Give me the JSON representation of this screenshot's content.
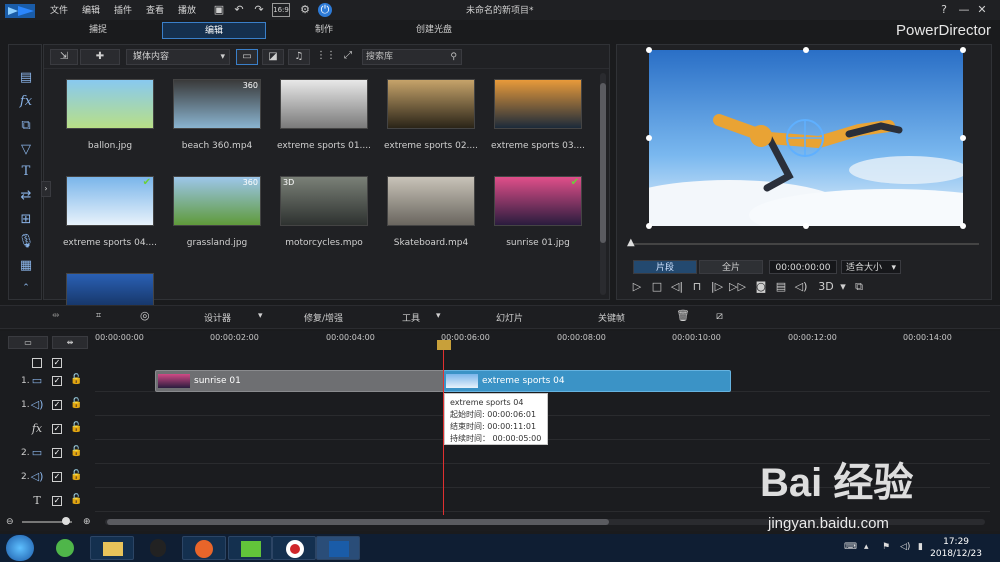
{
  "menu": [
    "文件",
    "编辑",
    "插件",
    "查看",
    "播放"
  ],
  "window_title": "未命名的新项目*",
  "brand": "PowerDirector",
  "modes": [
    {
      "label": "捕捉"
    },
    {
      "label": "编辑",
      "active": true
    },
    {
      "label": "制作"
    },
    {
      "label": "创建光盘"
    }
  ],
  "library": {
    "filter": "媒体内容",
    "search_placeholder": "搜索库",
    "items": [
      {
        "label": "ballon.jpg",
        "badge": "",
        "check": false,
        "colors": [
          "#88c9f0",
          "#b8df86"
        ]
      },
      {
        "label": "beach 360.mp4",
        "badge": "360",
        "check": false,
        "colors": [
          "#3a3a3a",
          "#8ab4d0"
        ]
      },
      {
        "label": "extreme sports 01....",
        "badge": "",
        "check": false,
        "colors": [
          "#e8e8e8",
          "#7a7a7a"
        ]
      },
      {
        "label": "extreme sports 02....",
        "badge": "",
        "check": false,
        "colors": [
          "#c6a36a",
          "#2a2418"
        ]
      },
      {
        "label": "extreme sports 03....",
        "badge": "",
        "check": false,
        "colors": [
          "#e89a3a",
          "#1c2a3a"
        ]
      },
      {
        "label": "extreme sports 04....",
        "badge": "",
        "check": true,
        "colors": [
          "#7ab5ea",
          "#e8f2fb"
        ]
      },
      {
        "label": "grassland.jpg",
        "badge": "360",
        "check": false,
        "colors": [
          "#9dc6ea",
          "#5f9a3a"
        ]
      },
      {
        "label": "motorcycles.mpo",
        "badge": "3D",
        "check": false,
        "colors": [
          "#7a8077",
          "#2e3230"
        ]
      },
      {
        "label": "Skateboard.mp4",
        "badge": "",
        "check": false,
        "colors": [
          "#c8c3b8",
          "#6a665f"
        ]
      },
      {
        "label": "sunrise 01.jpg",
        "badge": "",
        "check": true,
        "colors": [
          "#e04f8a",
          "#2a1c3e"
        ]
      },
      {
        "label": "",
        "badge": "",
        "check": false,
        "colors": [
          "#2a60b4",
          "#0d2244"
        ]
      }
    ]
  },
  "preview": {
    "tab_clip": "片段",
    "tab_full": "全片",
    "timecode": "00:00:00:00",
    "fit": "适合大小",
    "mode3d": "3D"
  },
  "timeline_toolbar": {
    "designer": "设计器",
    "fix": "修复/增强",
    "tools": "工具",
    "slideshow": "幻灯片",
    "keyframe": "关键帧"
  },
  "ruler": [
    "00:00:00:00",
    "00:00:02:00",
    "00:00:04:00",
    "00:00:06:00",
    "00:00:08:00",
    "00:00:10:00",
    "00:00:12:00",
    "00:00:14:00"
  ],
  "tracks": [
    {
      "label": "1.",
      "icon": "video-track-icon"
    },
    {
      "label": "1.",
      "icon": "audio-track-icon"
    },
    {
      "label": "",
      "icon": "fx-track-icon"
    },
    {
      "label": "2.",
      "icon": "video-track-icon"
    },
    {
      "label": "2.",
      "icon": "audio-track-icon"
    },
    {
      "label": "",
      "icon": "title-track-icon"
    }
  ],
  "clips": {
    "sunrise": "sunrise 01",
    "extreme": "extreme sports 04"
  },
  "tooltip": {
    "title": "extreme sports 04",
    "start": "起始时间: 00:00:06:01",
    "end": "结束时间: 00:00:11:01",
    "duration": "持续时间： 00:00:05:00"
  },
  "taskbar": {
    "time": "17:29",
    "date": "2018/12/23"
  },
  "watermark": {
    "main": "Bai 经验",
    "sub": "jingyan.baidu.com"
  }
}
